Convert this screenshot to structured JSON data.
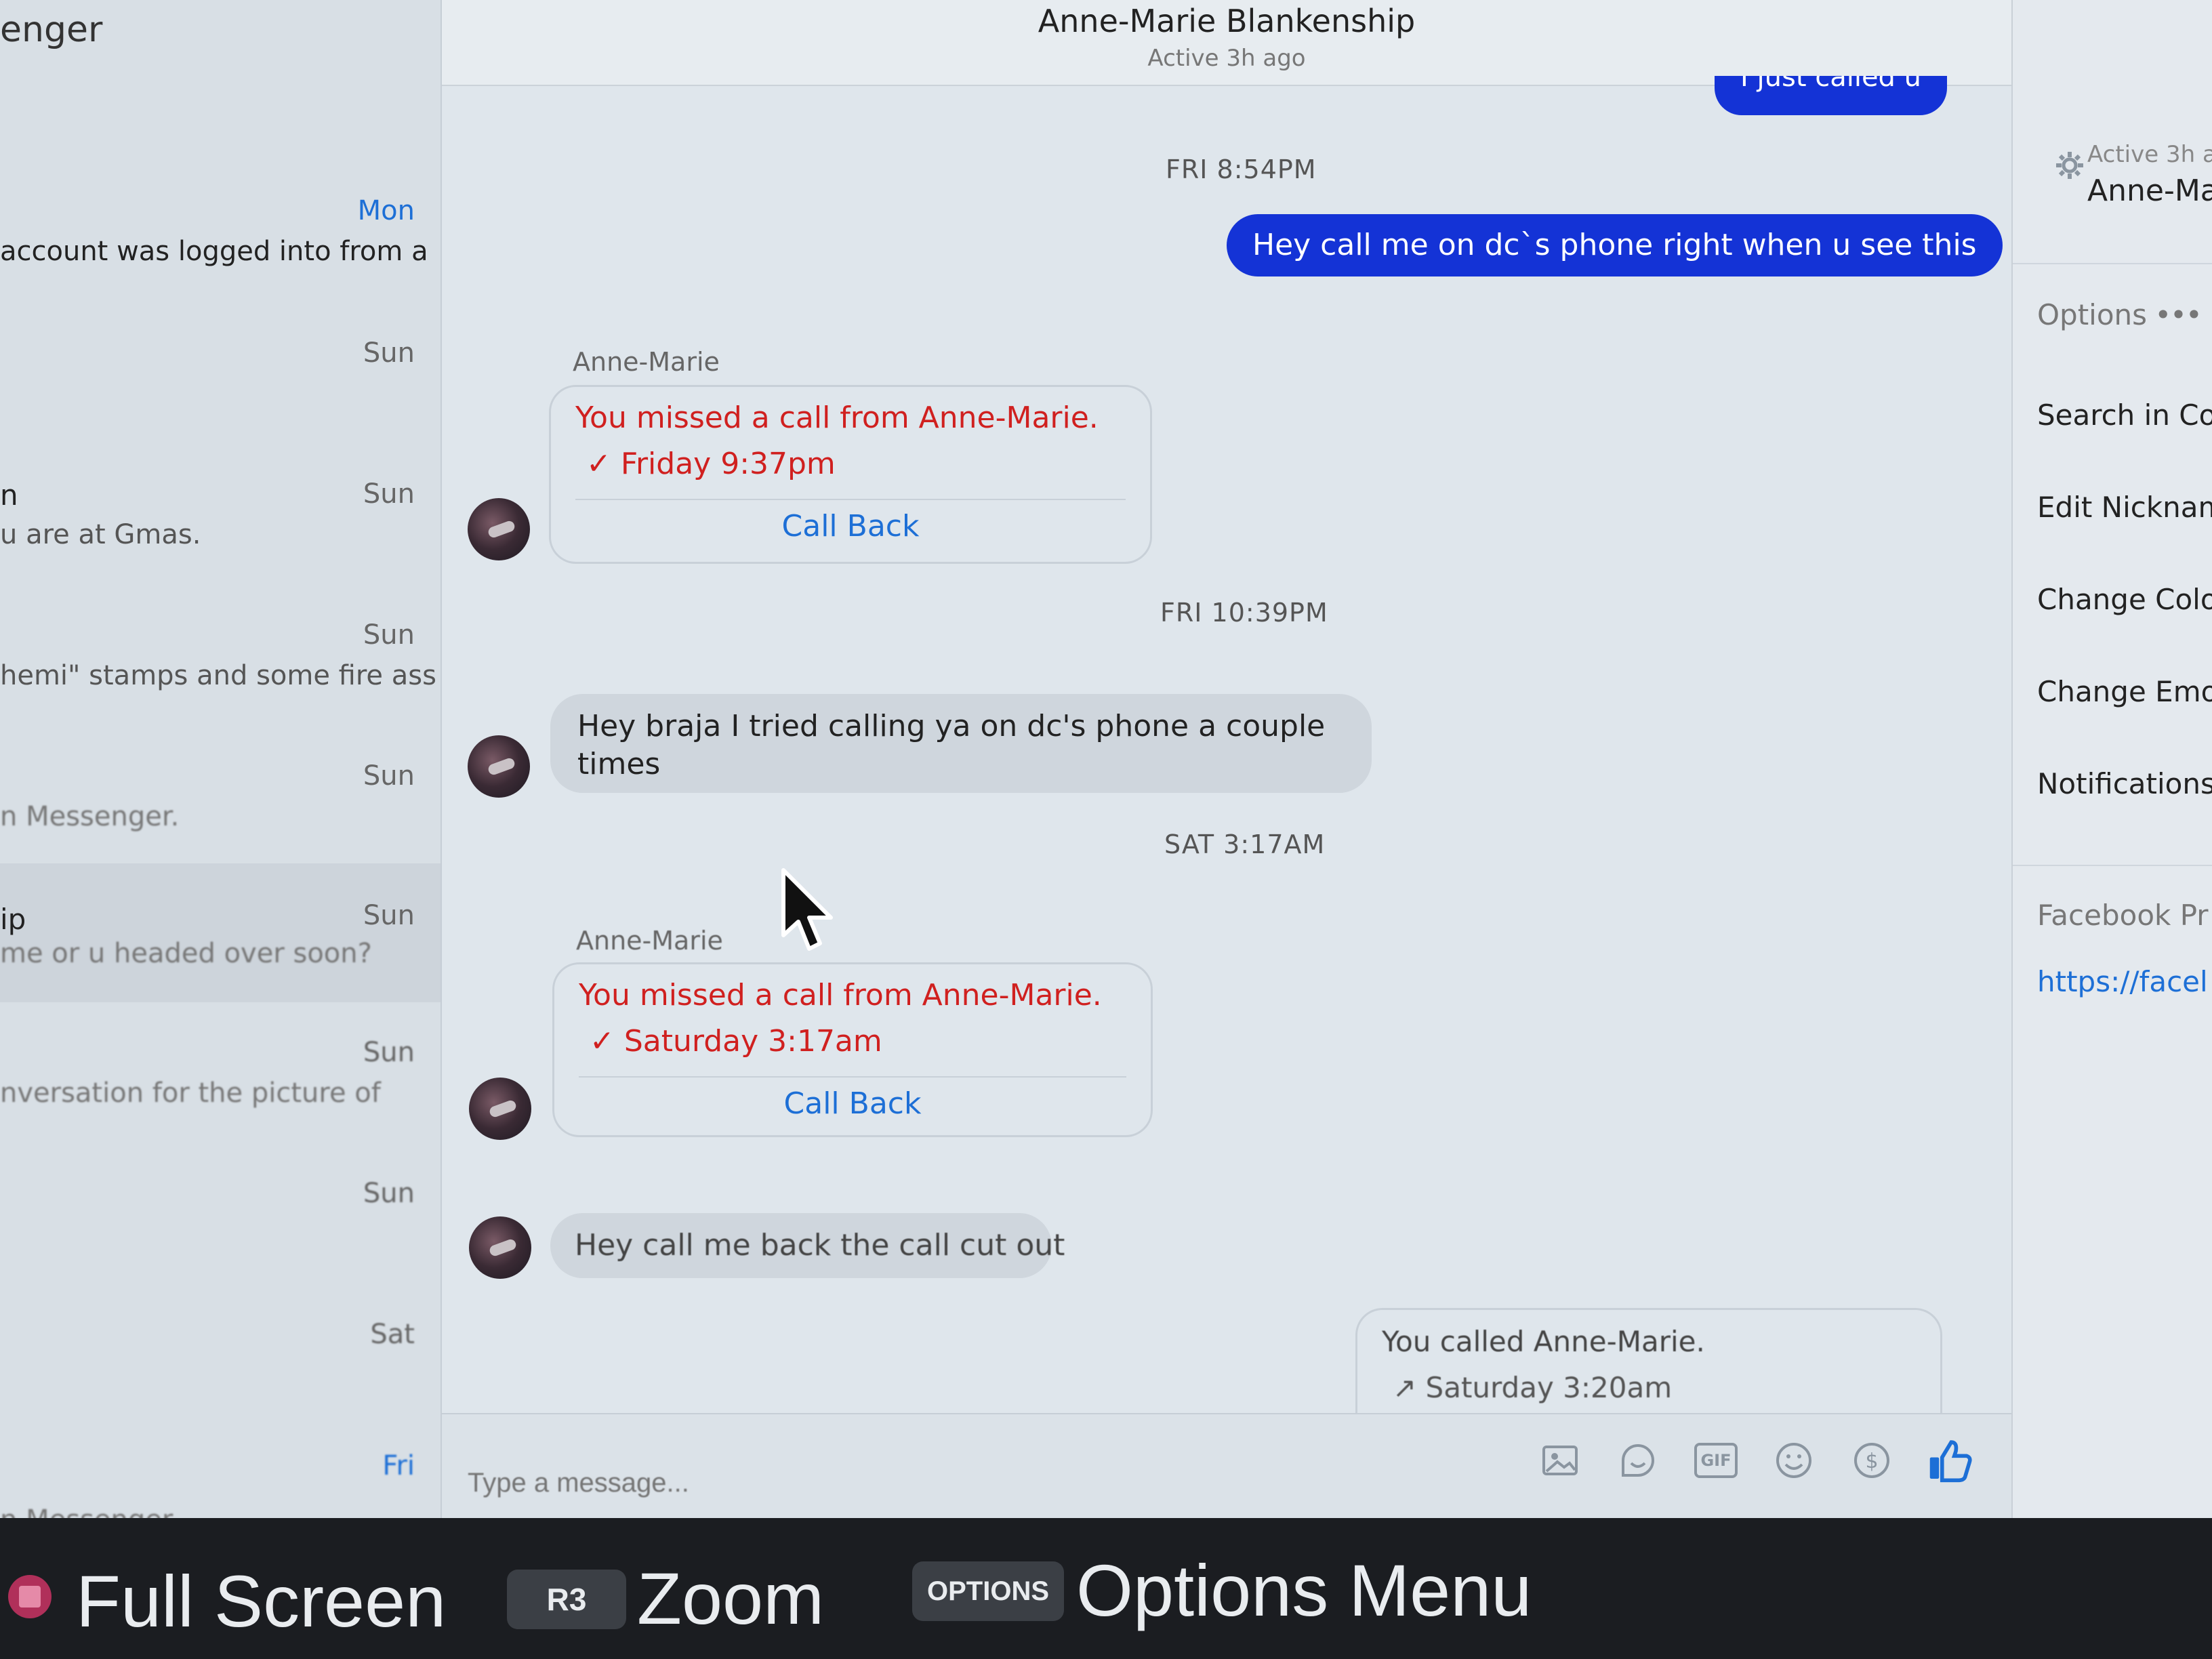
{
  "left": {
    "app_name": "enger",
    "conversations": [
      {
        "name": "",
        "time": "Mon",
        "snippet": "account was logged into from a"
      },
      {
        "name": "",
        "time": "Sun",
        "snippet": ""
      },
      {
        "name": "n",
        "time": "Sun",
        "snippet": "u are at Gmas."
      },
      {
        "name": "",
        "time": "Sun",
        "snippet": "hemi\" stamps and some fire ass"
      },
      {
        "name": "",
        "time": "Sun",
        "snippet": "n Messenger."
      },
      {
        "name": "ip",
        "time": "Sun",
        "snippet": "me or u headed over soon?"
      },
      {
        "name": "",
        "time": "Sun",
        "snippet": "nversation for the picture of"
      },
      {
        "name": "",
        "time": "Sun",
        "snippet": ""
      },
      {
        "name": "",
        "time": "Sat",
        "snippet": ""
      },
      {
        "name": "",
        "time": "Fri",
        "snippet": "n Messenger."
      }
    ]
  },
  "header": {
    "title": "Anne-Marie Blankenship",
    "subtitle": "Active 3h ago"
  },
  "chat": {
    "top_bubble_partial": "I just called u",
    "ts1": "FRI 8:54PM",
    "out1": "Hey call me on dc`s phone right when u see this",
    "sender1": "Anne-Marie",
    "call1": {
      "missed": "You missed a call from Anne-Marie.",
      "when": "Friday 9:37pm",
      "action": "Call Back"
    },
    "ts2": "FRI 10:39PM",
    "in1_line1": "Hey braja I tried calling ya on dc's phone a couple",
    "in1_line2": "times",
    "ts3": "SAT 3:17AM",
    "sender2": "Anne-Marie",
    "call2": {
      "missed": "You missed a call from Anne-Marie.",
      "when": "Saturday 3:17am",
      "action": "Call Back"
    },
    "in2": "Hey call me back the call cut out",
    "outcall": {
      "line1": "You called Anne-Marie.",
      "line2": "Saturday 3:20am"
    }
  },
  "composer": {
    "placeholder": "Type a message...",
    "gif_label": "GIF"
  },
  "right": {
    "active": "Active 3h a",
    "name": "Anne-Ma",
    "options_label": "Options",
    "items": [
      "Search in Cor",
      "Edit Nicknam",
      "Change Colo",
      "Change Emo",
      "Notifications"
    ],
    "profile_label": "Facebook Pr",
    "profile_link": "https://facel"
  },
  "bottom_bar": {
    "fullscreen_label": "Full Screen",
    "r3_key": "R3",
    "zoom_label": "Zoom",
    "options_key": "OPTIONS",
    "options_label": "Options Menu"
  }
}
